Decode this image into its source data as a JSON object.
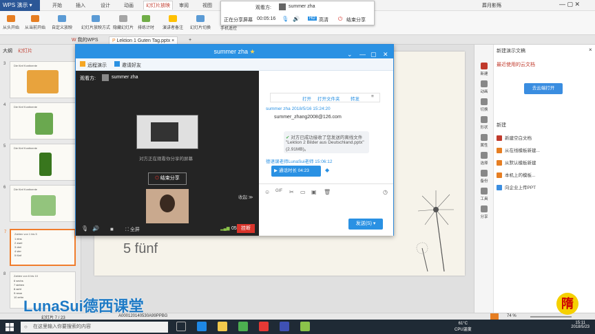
{
  "app": {
    "name": "WPS 演示",
    "menu_tabs": [
      "开始",
      "插入",
      "设计",
      "动画",
      "幻灯片放映",
      "审阅",
      "视图"
    ],
    "active_tab": "幻灯片放映",
    "user": "葬月影殇"
  },
  "ribbon": {
    "buttons": [
      "从头开始",
      "从当前开始",
      "自定义放映",
      "幻灯片放映方式",
      "隐藏幻灯片",
      "排练计时",
      "演讲者备注",
      "幻灯片切换",
      "手机遥控"
    ]
  },
  "doc_tabs": [
    "我的WPS",
    "Lektion 1 Guten Tag.pptx"
  ],
  "left_panel": {
    "tabs": [
      "大纲",
      "幻灯片"
    ],
    "slides": [
      {
        "num": "3",
        "title": "Die fünf Kontinente"
      },
      {
        "num": "4",
        "title": "Die fünf Kontinente"
      },
      {
        "num": "5",
        "title": "Die fünf Kontinente"
      },
      {
        "num": "6",
        "title": "Die fünf Kontinente"
      },
      {
        "num": "7",
        "title": "Zahlen von 1 bis 5",
        "lines": [
          "1 eins",
          "2 zwei",
          "3 drei",
          "4 vier",
          "5 fünf"
        ]
      },
      {
        "num": "8",
        "title": "Zahlen von 6 bis 10",
        "lines": [
          "6 sechs",
          "7 sieben",
          "8 acht",
          "9 neun",
          "10 zehn"
        ]
      }
    ]
  },
  "slide": {
    "visible_text": "5 fünf"
  },
  "share_bar": {
    "viewer_label": "观看方:",
    "viewer_name": "summer zha",
    "status": "正在分享屏幕",
    "timer": "00:05:16",
    "hd": "HD",
    "highdef": "高清",
    "end": "结束分享"
  },
  "chat_window": {
    "title": "summer zha",
    "tabs": [
      "远程演示",
      "邀请好友"
    ],
    "viewer_label": "观看方:",
    "viewer_name": "summer zha",
    "shared_text": "对方正在观看你分享的屏幕",
    "end_share": "结束分享",
    "collapse": "收起",
    "video_timer": "05:18",
    "hangup": "挂断",
    "fullscreen": "全屏",
    "file_actions": [
      "打开",
      "打开文件夹",
      "转发"
    ],
    "msg_header": "summer zha 2018/5/16 15:24:20",
    "msg_text": "summer_zhang2008@126.com",
    "file_msg": "对方已成功接收了您发送的离线文件 \"Lektion 2 Bilder aus Deutschland.pptx\" (2.91MB)。",
    "msg_header_2": "德语课老师LunaSui老师 15:06:12",
    "call_duration": "通话时长 04:23",
    "send": "发送(S)"
  },
  "right_panel": {
    "title": "新建演示文稿",
    "recent_section": "最近使用的云文档",
    "open_button": "去云端打开",
    "new_section": "新建",
    "items": [
      "新建空白文档",
      "从在线模板新建...",
      "从默认模板新建",
      "本机上的模板...",
      "向企业上传PPT"
    ],
    "icon_bar": [
      "新建",
      "动画",
      "切换",
      "形状",
      "属性",
      "选择",
      "备份",
      "工具",
      "分享"
    ]
  },
  "status_bar": {
    "slide_info": "幻灯片 7 / 23",
    "doc_id": "A000120140530A99PPBG",
    "zoom": "74 %"
  },
  "taskbar": {
    "search_placeholder": "在这里输入你要搜索的内容",
    "temp": "61°C",
    "cpu": "CPU温度",
    "time": "15:11",
    "date": "2018/5/23"
  },
  "watermark": {
    "text": "LunaSui德西课堂",
    "logo_char": "隋"
  },
  "colors": {
    "accent": "#2a91e3",
    "wps_blue": "#2b5797",
    "selected_slide": "#f07c2b",
    "hangup_red": "#d9342b"
  }
}
